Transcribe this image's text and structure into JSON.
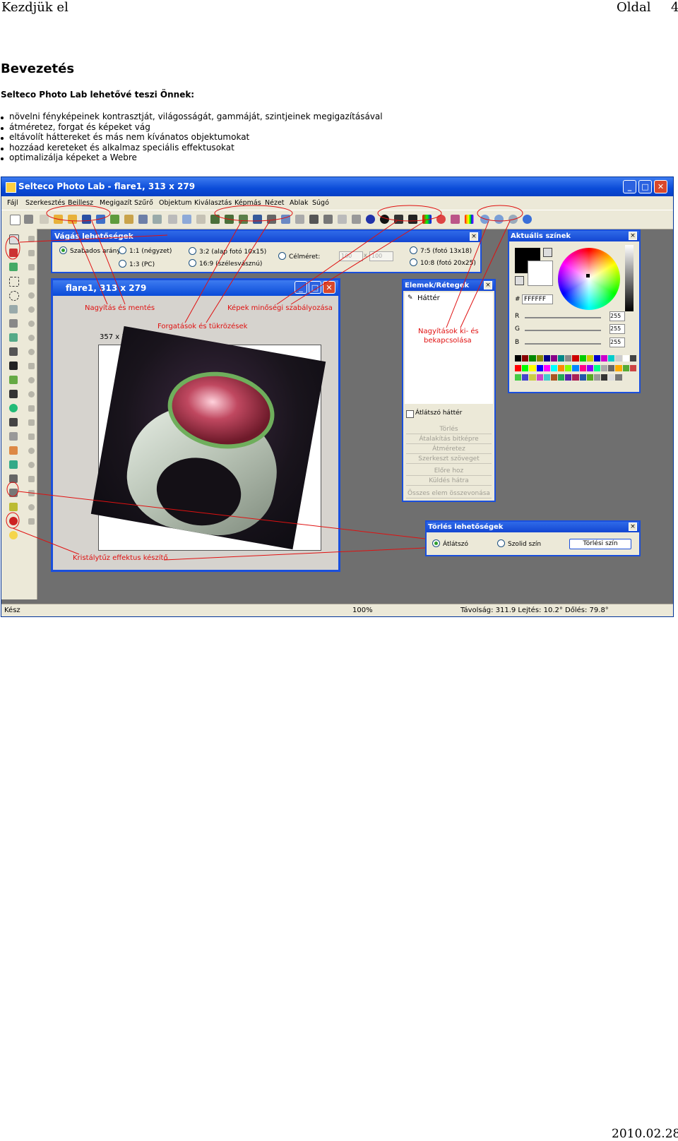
{
  "page_header": {
    "left": "Kezdjük el",
    "right": "Oldal",
    "page_number": "4"
  },
  "heading": "Bevezetés",
  "subheading": "Selteco Photo Lab lehetővé teszi Önnek:",
  "features": [
    "növelni fényképeinek kontrasztját, világosságát, gammáját, szintjeinek megigazításával",
    "átméretez, forgat és képeket vág",
    "eltávolít háttereket és más nem kívánatos objektumokat",
    "hozzáad kereteket és alkalmaz speciális effektusokat",
    "optimalizálja képeket a Webre"
  ],
  "footer_date": "2010.02.28.",
  "app": {
    "title": "Selteco Photo Lab - flare1, 313 x 279",
    "menu": [
      "Fájl",
      "Szerkesztés",
      "Beillesz",
      "Megigazít",
      "Szűrő",
      "Objektum",
      "Kiválasztás",
      "Képmás",
      "Nézet",
      "Ablak",
      "Súgó"
    ],
    "crop_panel": {
      "title": "Vágás lehetőségek",
      "options": [
        "Szabados arány",
        "1:1 (négyzet)",
        "1:3 (PC)",
        "3:2 (alap fotó 10x15)",
        "16:9 (szélesvásznú)",
        "Célméret:",
        "7:5 (fotó 13x18)",
        "10:8 (fotó 20x25)"
      ],
      "target_w": "100",
      "target_h": "100",
      "x_label": "x"
    },
    "image_window": {
      "title": "flare1, 313 x 279",
      "coords": "357 x 330"
    },
    "layers_panel": {
      "title": "Elemek/Rétegek",
      "item": "Háttér",
      "transparent_label": "Átlátszó háttér",
      "buttons": [
        "Törlés",
        "Átalakítás bitképre",
        "Átméretez",
        "Szerkeszt szöveget",
        "Előre hoz",
        "Küldés hátra",
        "Összes elem összevonása"
      ]
    },
    "colors_panel": {
      "title": "Aktuális színek",
      "hex_label": "#",
      "hex_value": "FFFFFF",
      "channels": [
        {
          "label": "R",
          "value": "255"
        },
        {
          "label": "G",
          "value": "255"
        },
        {
          "label": "B",
          "value": "255"
        }
      ]
    },
    "erase_panel": {
      "title": "Törlés lehetőségek",
      "opt1": "Átlátszó",
      "opt2": "Szolid szín",
      "button": "Törlési szín"
    },
    "annotations": {
      "zoom_save": "Nagyítás és mentés",
      "quality": "Képek minőségi szabályozása",
      "rotate": "Forgatások és tükrözések",
      "zoom_toggle_1": "Nagyítások ki- és",
      "zoom_toggle_2": "bekapcsolása",
      "crystal": "Kristálytűz effektus készítő"
    },
    "status": {
      "ready": "Kész",
      "zoom": "100%",
      "distance": "Távolság: 311.9  Lejtés: 10.2°  Dőlés: 79.8°"
    }
  }
}
